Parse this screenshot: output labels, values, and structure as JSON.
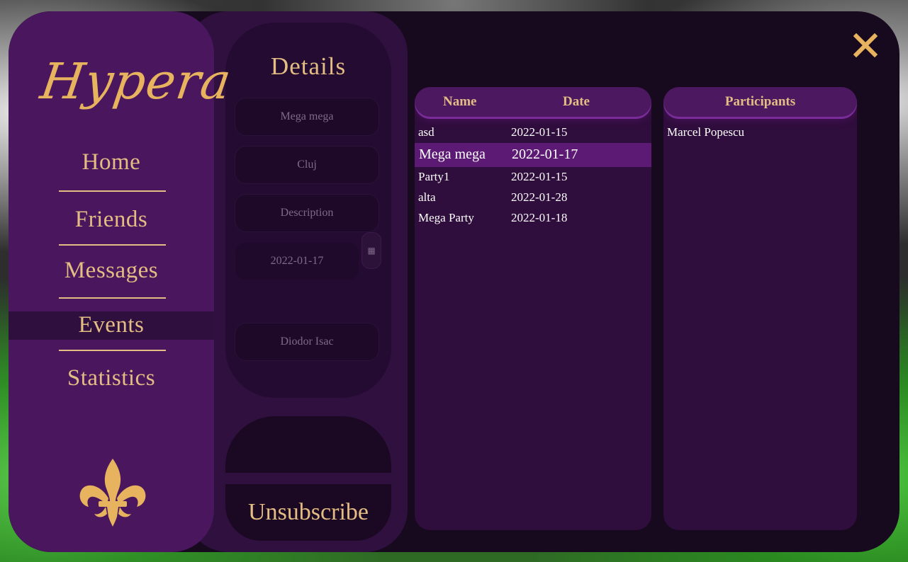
{
  "app": {
    "logo_text": "Hypera",
    "accent_color": "#e3bd83",
    "selected_row_color": "#5c1a75"
  },
  "sidebar": {
    "items": [
      {
        "label": "Home"
      },
      {
        "label": "Friends"
      },
      {
        "label": "Messages"
      },
      {
        "label": "Events",
        "active": true
      },
      {
        "label": "Statistics"
      }
    ],
    "emblem_icon": "fleur-de-lis-icon"
  },
  "details": {
    "title": "Details",
    "name_value": "Mega mega",
    "location_value": "Cluj",
    "description_placeholder": "Description",
    "date_value": "2022-01-17",
    "calendar_icon": "calendar-icon",
    "organizer_value": "Diodor Isac",
    "unsubscribe_label": "Unsubscribe"
  },
  "events": {
    "columns": [
      "Name",
      "Date"
    ],
    "rows": [
      {
        "name": "asd",
        "date": "2022-01-15"
      },
      {
        "name": "Mega mega",
        "date": "2022-01-17",
        "selected": true
      },
      {
        "name": "Party1",
        "date": "2022-01-15"
      },
      {
        "name": "alta",
        "date": "2022-01-28"
      },
      {
        "name": "Mega Party",
        "date": "2022-01-18"
      }
    ]
  },
  "participants": {
    "columns": [
      "Participants"
    ],
    "rows": [
      {
        "name": "Marcel Popescu"
      }
    ]
  },
  "window": {
    "close_icon": "close-icon"
  }
}
